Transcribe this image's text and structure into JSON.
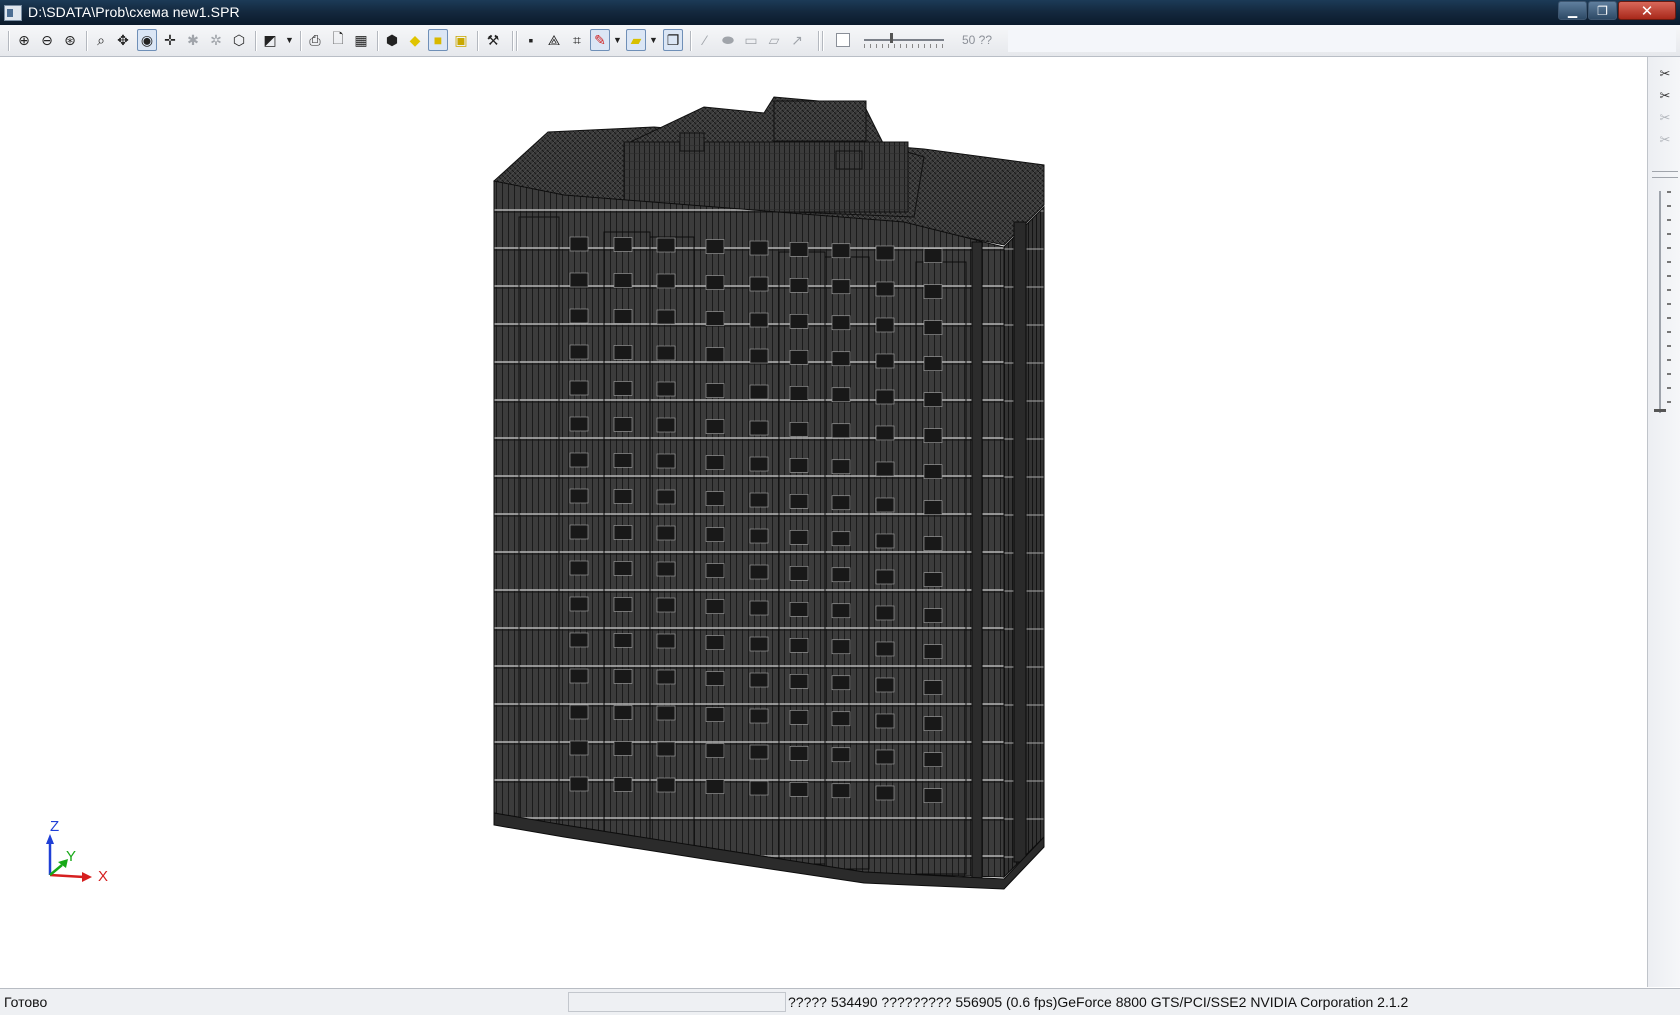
{
  "window": {
    "title": "D:\\SDATA\\Prob\\схема new1.SPR",
    "controls": {
      "minimize": "▁",
      "maximize": "❐",
      "close": "✕"
    }
  },
  "toolbar": {
    "icons": [
      "zoom-in-icon",
      "zoom-out-icon",
      "zoom-window-icon",
      "zoom-all-icon",
      "pan-icon",
      "rotate-icon",
      "crosshair-icon",
      "select-nodes-icon",
      "select-elements-icon",
      "view-3d-icon",
      "projection-icon",
      "print-icon",
      "print-preview-icon",
      "export-icon",
      "wireframe-icon",
      "shaded-icon",
      "solid-icon",
      "solid-edges-icon",
      "tools-icon",
      "node-icon",
      "supports-icon",
      "grid-icon",
      "edit-color-icon",
      "fill-color-icon",
      "layer-icon",
      "brush-icon",
      "eraser-icon",
      "rect-icon",
      "slice-icon",
      "arrow-icon"
    ],
    "slider_value_text": "50 ??"
  },
  "viewport": {
    "axes": {
      "z": "Z",
      "y": "Y",
      "x": "X"
    },
    "colors": {
      "building_fill": "#3a3a3a",
      "mesh_lines": "#1a1a1a",
      "highlight": "#bfbfbf",
      "axis_z": "#1f3fd6",
      "axis_y": "#17a917",
      "axis_x": "#d61f1f"
    }
  },
  "side_toolbar": {
    "icons": [
      "cut-plane-icon",
      "cut-plane-active-icon",
      "cut-plane-dim-icon",
      "cut-plane-disabled-icon"
    ]
  },
  "status": {
    "left": "Готово",
    "right": "????? 534490  ????????? 556905  (0.6 fps)GeForce 8800 GTS/PCI/SSE2 NVIDIA Corporation 2.1.2"
  }
}
